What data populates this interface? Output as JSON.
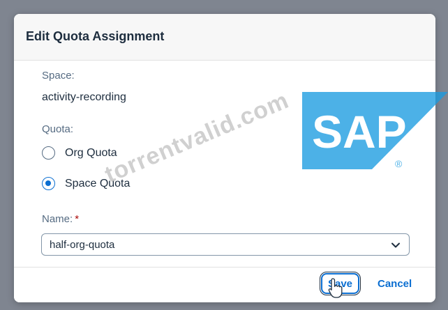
{
  "dialog": {
    "title": "Edit Quota Assignment",
    "space_label": "Space:",
    "space_value": "activity-recording",
    "quota_label": "Quota:",
    "quota_options": [
      {
        "label": "Org Quota",
        "selected": false
      },
      {
        "label": "Space Quota",
        "selected": true
      }
    ],
    "name_label": "Name:",
    "name_required_mark": "*",
    "name_value": "half-org-quota",
    "save_label": "Save",
    "cancel_label": "Cancel"
  },
  "watermark_text": "torrentvalid.com",
  "logo_text": "SAP",
  "colors": {
    "accent": "#0a6ed1",
    "required": "#aa0808",
    "backdrop": "#7f8590",
    "logo_blue": "#1a9be0"
  },
  "icons": [
    "chevron-down-icon",
    "pointer-cursor-icon",
    "sap-logo"
  ]
}
